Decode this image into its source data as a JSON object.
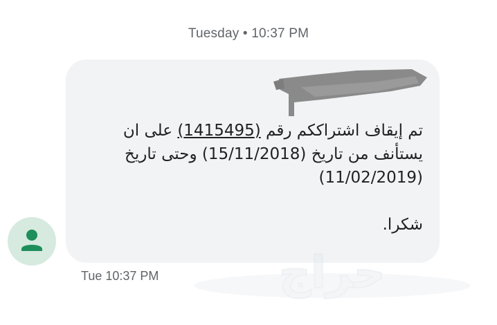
{
  "conversation": {
    "date_header": "Tuesday • 10:37 PM",
    "message": {
      "line1_prefix": "تم إيقاف اشتراككم رقم ",
      "subscription_number": "(1415495)",
      "line1_suffix": " على ان",
      "line2": "يستأنف من تاريخ (15/11/2018) وحتى تاريخ",
      "line3": "(11/02/2019)",
      "closing": "شكرا."
    },
    "timestamp": "Tue 10:37 PM",
    "sender_avatar_icon": "person-icon",
    "sender_name_redacted": true
  },
  "watermark": {
    "text": "حراج"
  },
  "colors": {
    "bubble": "#f1f3f4",
    "avatar_bg": "#d6eadf",
    "avatar_fg": "#1e8e5a",
    "meta_text": "#5f6368",
    "body_text": "#202124",
    "redaction": "#8a8a8a"
  }
}
